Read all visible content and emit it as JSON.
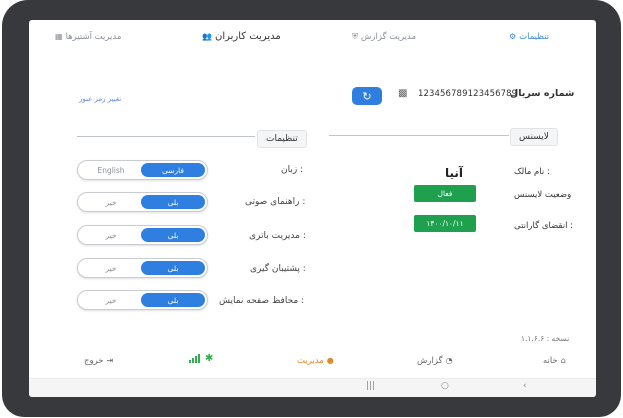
{
  "topnav": {
    "settings": "تنظیمات",
    "report_management": "مدیریت گزارش",
    "user_management": "مدیریت کاربران",
    "unit_management": "مدیریت آشتیرها"
  },
  "serial": {
    "label": "شماره سریال",
    "value": "123456789123456789",
    "change_password": "تغییر رمز عبور"
  },
  "license_section": {
    "title": "لایسنس",
    "owner_label": "نام مالک :",
    "owner_value": "آنیا",
    "status_label": "وضعیت لایسنس",
    "status_value": "فعال",
    "warranty_label": "انقضای گارانتی :",
    "warranty_value": "۱۴۰۰/۱۰/۱۱"
  },
  "settings_section": {
    "title": "تنظیمات",
    "rows": [
      {
        "label": "زبان :",
        "on": "فارسی",
        "off": "English"
      },
      {
        "label": "راهنمای صوتی :",
        "on": "بلی",
        "off": "خیر"
      },
      {
        "label": "مدیریت باتری :",
        "on": "بلی",
        "off": "خیر"
      },
      {
        "label": "پشتیبان گیری :",
        "on": "بلی",
        "off": "خیر"
      },
      {
        "label": "محافظ صفحه نمایش :",
        "on": "بلی",
        "off": "خیر"
      }
    ]
  },
  "version": "نسخه : ۱.۱.۶.۶",
  "bottomnav": {
    "home": "خانه",
    "report": "گزارش",
    "manage": "مدیریت",
    "exit": "خروج"
  },
  "colors": {
    "accent": "#2f7fe0",
    "success": "#1fa04f",
    "warning": "#e08a30"
  }
}
